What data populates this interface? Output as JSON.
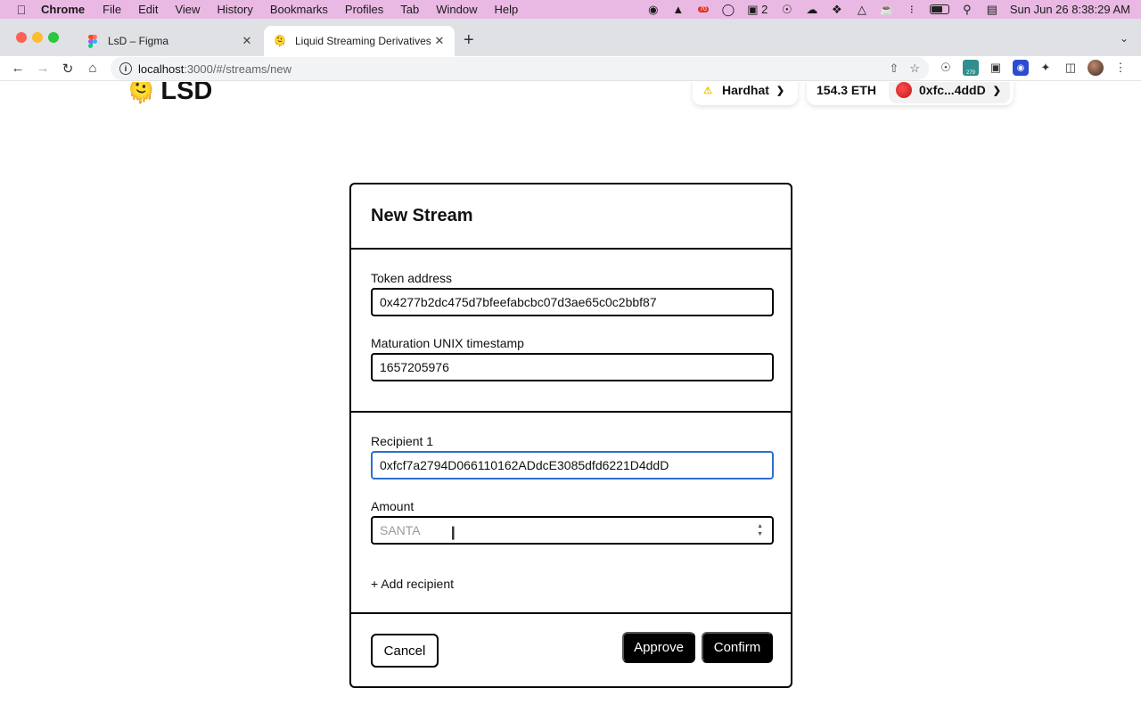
{
  "menubar": {
    "apple": "",
    "items": [
      "Chrome",
      "File",
      "Edit",
      "View",
      "History",
      "Bookmarks",
      "Profiles",
      "Tab",
      "Window",
      "Help"
    ],
    "status_badge": "70",
    "stack_count": "2",
    "datetime": "Sun Jun 26  8:38:29 AM"
  },
  "tabs": [
    {
      "title": "LsD – Figma",
      "icon": "figma-icon"
    },
    {
      "title": "Liquid Streaming Derivatives",
      "icon": "lsd-emoji-icon"
    }
  ],
  "address_bar": {
    "host": "localhost",
    "path": ":3000/#/streams/new"
  },
  "extension_badge": "279",
  "header": {
    "logo_emoji": "🫠",
    "logo_text": "LSD",
    "network": "Hardhat",
    "balance": "154.3 ETH",
    "account": "0xfc...4ddD"
  },
  "form": {
    "title": "New Stream",
    "token_label": "Token address",
    "token_value": "0x4277b2dc475d7bfeefabcbc07d3ae65c0c2bbf87",
    "maturation_label": "Maturation UNIX timestamp",
    "maturation_value": "1657205976",
    "recipient_label": "Recipient 1",
    "recipient_value": "0xfcf7a2794D066110162ADdcE3085dfd6221D4ddD",
    "amount_label": "Amount",
    "amount_placeholder": "SANTA",
    "add_recipient": "+ Add recipient",
    "cancel": "Cancel",
    "approve": "Approve",
    "confirm": "Confirm"
  },
  "colors": {
    "menubar": "#e9b9e3",
    "focus": "#2c6fcd",
    "primary_button": "#000000"
  }
}
